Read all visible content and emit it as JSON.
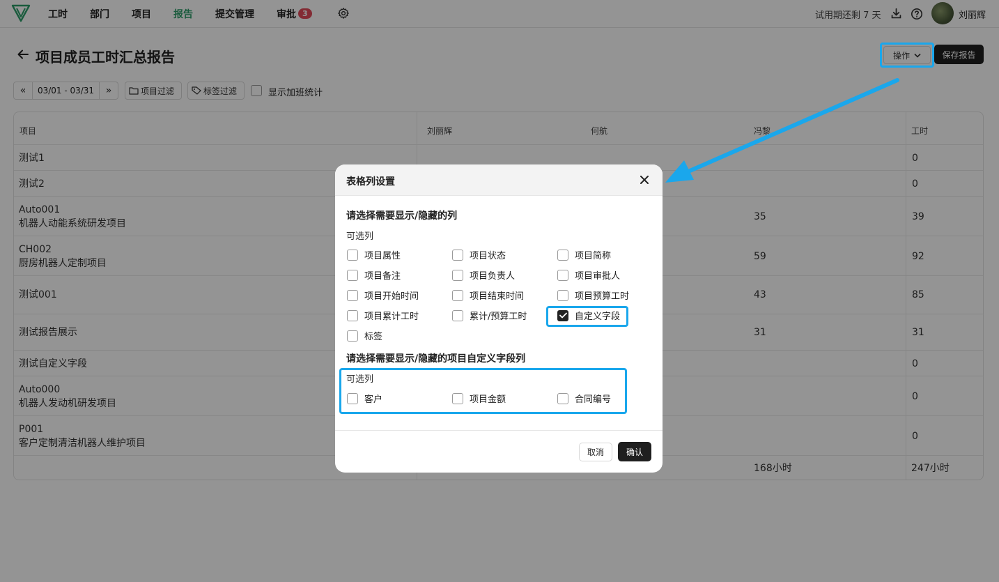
{
  "nav": {
    "items": [
      {
        "label": "工时"
      },
      {
        "label": "部门"
      },
      {
        "label": "项目"
      },
      {
        "label": "报告"
      },
      {
        "label": "提交管理"
      },
      {
        "label": "审批"
      }
    ],
    "approval_badge": "3",
    "active_item": "报告",
    "trial_text": "试用期还剩 7 天",
    "username": "刘丽辉",
    "accent_color": "#2e9e6a",
    "badge_color": "#e24b5b"
  },
  "page": {
    "title": "项目成员工时汇总报告",
    "ops_label": "操作",
    "save_label": "保存报告"
  },
  "filters": {
    "date_range": "03/01 - 03/31",
    "prev_icon": "«",
    "next_icon": "»",
    "project_filter_label": "项目过滤",
    "tag_filter_label": "标签过滤",
    "overtime_label": "显示加班统计"
  },
  "table": {
    "headers": [
      "项目",
      "刘丽辉",
      "何航",
      "冯黎",
      "工时"
    ],
    "rows": [
      {
        "code": "测试1",
        "name": "",
        "c3": "",
        "hours": "0"
      },
      {
        "code": "测试2",
        "name": "",
        "c3": "",
        "hours": "0"
      },
      {
        "code": "Auto001",
        "name": "机器人动能系统研发项目",
        "c3": "35",
        "hours": "39"
      },
      {
        "code": "CH002",
        "name": "厨房机器人定制项目",
        "c3": "59",
        "hours": "92"
      },
      {
        "code": "测试001",
        "name": "",
        "c3": "43",
        "hours": "85"
      },
      {
        "code": "测试报告展示",
        "name": "",
        "c3": "31",
        "hours": "31"
      },
      {
        "code": "测试自定义字段",
        "name": "",
        "c3": "",
        "hours": "0"
      },
      {
        "code": "Auto000",
        "name": "机器人发动机研发项目",
        "c3": "",
        "hours": "0"
      },
      {
        "code": "P001",
        "name": "客户定制清洁机器人维护项目",
        "c3": "",
        "hours": "0"
      }
    ],
    "total_c3": "168小时",
    "total_hours": "247小时"
  },
  "modal": {
    "title": "表格列设置",
    "section1_title": "请选择需要显示/隐藏的列",
    "section1_sub": "可选列",
    "options1": [
      {
        "label": "项目属性",
        "checked": false
      },
      {
        "label": "项目状态",
        "checked": false
      },
      {
        "label": "项目简称",
        "checked": false
      },
      {
        "label": "项目备注",
        "checked": false
      },
      {
        "label": "项目负责人",
        "checked": false
      },
      {
        "label": "项目审批人",
        "checked": false
      },
      {
        "label": "项目开始时间",
        "checked": false
      },
      {
        "label": "项目结束时间",
        "checked": false
      },
      {
        "label": "项目预算工时",
        "checked": false
      },
      {
        "label": "项目累计工时",
        "checked": false
      },
      {
        "label": "累计/预算工时",
        "checked": false
      },
      {
        "label": "自定义字段",
        "checked": true
      },
      {
        "label": "标签",
        "checked": false
      }
    ],
    "section2_title": "请选择需要显示/隐藏的项目自定义字段列",
    "section2_sub": "可选列",
    "options2": [
      {
        "label": "客户",
        "checked": false
      },
      {
        "label": "项目金额",
        "checked": false
      },
      {
        "label": "合同编号",
        "checked": false
      }
    ],
    "cancel_label": "取消",
    "confirm_label": "确认",
    "highlight_color": "#1aa7ec"
  }
}
